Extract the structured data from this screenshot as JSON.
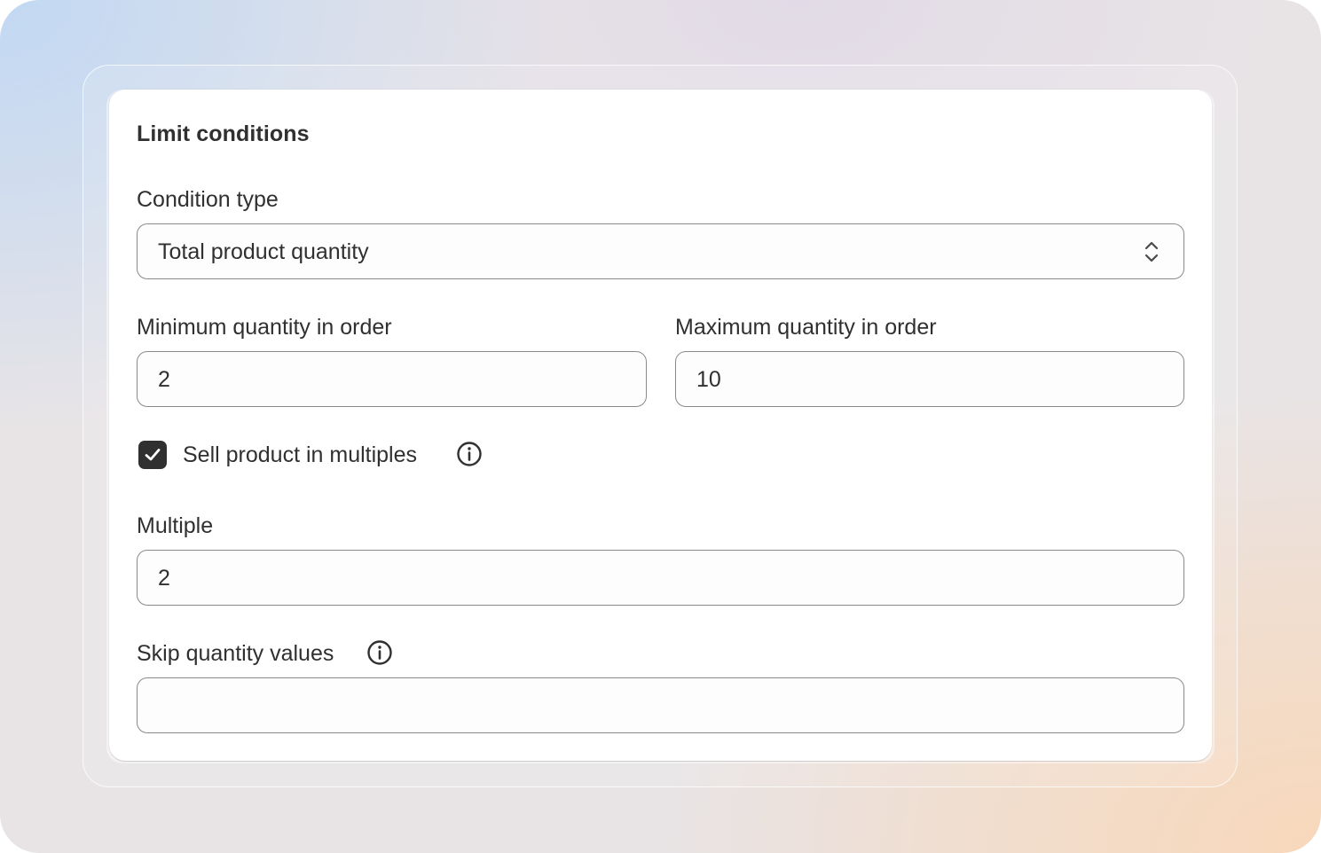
{
  "card": {
    "title": "Limit conditions"
  },
  "condition_type": {
    "label": "Condition type",
    "selected_value": "Total product quantity"
  },
  "min_quantity": {
    "label": "Minimum quantity in order",
    "value": "2"
  },
  "max_quantity": {
    "label": "Maximum quantity in order",
    "value": "10"
  },
  "sell_in_multiples": {
    "label": "Sell product in multiples",
    "checked": true,
    "info_icon": "info-icon"
  },
  "multiple": {
    "label": "Multiple",
    "value": "2"
  },
  "skip_quantity_values": {
    "label": "Skip quantity values",
    "value": "",
    "info_icon": "info-icon"
  },
  "colors": {
    "text": "#303030",
    "checkbox_fill": "#303030",
    "field_border": "#8a8a8a",
    "card_bg": "#ffffff"
  }
}
